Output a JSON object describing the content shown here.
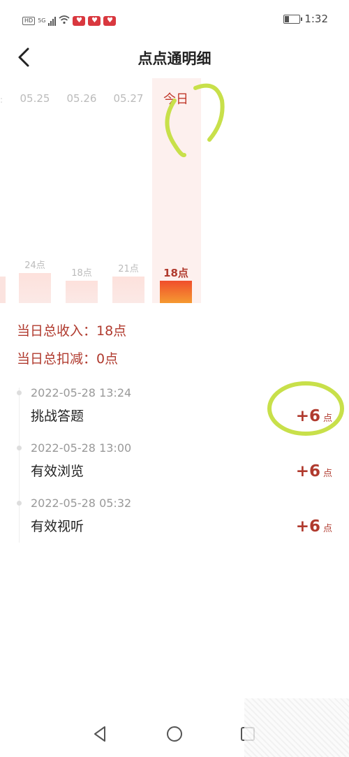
{
  "status_bar": {
    "hd": "HD",
    "network": "5G",
    "time": "1:32"
  },
  "header": {
    "title": "点点通明细",
    "back_icon": "chevron-left-icon"
  },
  "chart_data": {
    "type": "bar",
    "categories": [
      "05.25",
      "05.26",
      "05.27",
      "今日"
    ],
    "values": [
      24,
      18,
      21,
      18
    ],
    "value_labels": [
      "24点",
      "18点",
      "21点",
      "18点"
    ],
    "highlight_index": 3,
    "colors": {
      "normal": "#fde3de",
      "highlight": "#f15a2b"
    }
  },
  "summary": {
    "income": "当日总收入：18点",
    "deduction": "当日总扣减：0点"
  },
  "records": [
    {
      "time": "2022-05-28 13:24",
      "desc": "挑战答题",
      "points": "+6",
      "unit": "点"
    },
    {
      "time": "2022-05-28 13:00",
      "desc": "有效浏览",
      "points": "+6",
      "unit": "点"
    },
    {
      "time": "2022-05-28 05:32",
      "desc": "有效视听",
      "points": "+6",
      "unit": "点"
    }
  ],
  "nav": {
    "back_icon": "triangle-back-icon",
    "home_icon": "circle-home-icon",
    "recent_icon": "square-recent-icon"
  },
  "colors": {
    "accent": "#b03a2e",
    "annotation": "#c8e04a"
  }
}
